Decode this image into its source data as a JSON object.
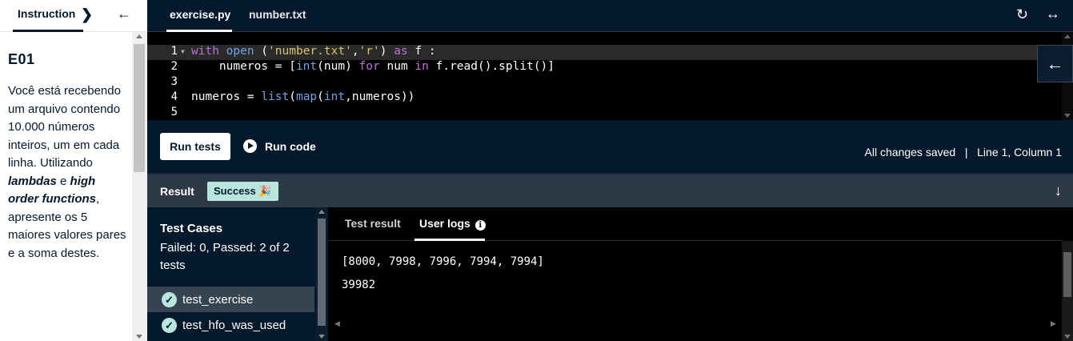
{
  "left_panel": {
    "tab_label": "Instruction",
    "exercise_title": "E01",
    "text_before": "Você está recebendo um arquivo contendo 10.000 números inteiros, um em cada linha. Utilizando ",
    "bold_1": "lambdas",
    "text_mid": " e ",
    "bold_2": "high order functions",
    "text_after": ", apresente os 5 maiores valores pares e a soma destes."
  },
  "editor": {
    "tabs": [
      "exercise.py",
      "number.txt"
    ],
    "active_tab": "exercise.py",
    "line_numbers": [
      "1",
      "2",
      "3",
      "4",
      "5"
    ],
    "code_lines": [
      "with open ('number.txt','r') as f :",
      "    numeros = [int(num) for num in f.read().split()]",
      "",
      "numeros = list(map(int,numeros))",
      ""
    ]
  },
  "run_bar": {
    "run_tests_label": "Run tests",
    "run_code_label": "Run code",
    "status_text": "All changes saved   |   Line 1, Column 1"
  },
  "result": {
    "label": "Result",
    "badge": "Success 🎉",
    "test_cases_title": "Test Cases",
    "test_summary": "Failed: 0, Passed: 2 of 2 tests",
    "tests": [
      "test_exercise",
      "test_hfo_was_used"
    ],
    "log_tabs": [
      "Test result",
      "User logs"
    ],
    "active_log_tab": "User logs",
    "logs": [
      "[8000, 7998, 7996, 7994, 7994]",
      "39982"
    ]
  },
  "colors": {
    "navy": "#05192d",
    "success_mint": "#b8e6df",
    "keyword": "#bf6fd9",
    "string": "#d8c468",
    "function": "#6fa3e8"
  }
}
